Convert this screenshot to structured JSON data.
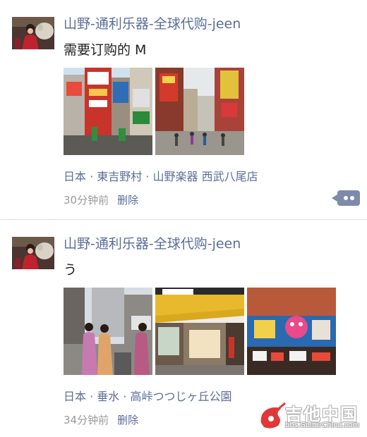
{
  "posts": [
    {
      "author": "山野-通利乐器-全球代购-jeen",
      "content": "需要订购的 M",
      "location": "日本 · 東吉野村 · 山野楽器 西武八尾店",
      "time": "30分钟前",
      "delete_label": "删除",
      "photo_count": 2
    },
    {
      "author": "山野-通利乐器-全球代购-jeen",
      "content": "う",
      "location": "日本 · 垂水 · 高峠つつじヶ丘公園",
      "time": "34分钟前",
      "delete_label": "删除",
      "photo_count": 3
    }
  ],
  "watermark": {
    "title": "吉他中国",
    "url": "bbs.GuitarChina.com"
  },
  "colors": {
    "author": "#5a6e9a",
    "meta_time": "#9a9a9a",
    "comment_button": "#7e8aa9",
    "divider": "#dcdcdc"
  }
}
